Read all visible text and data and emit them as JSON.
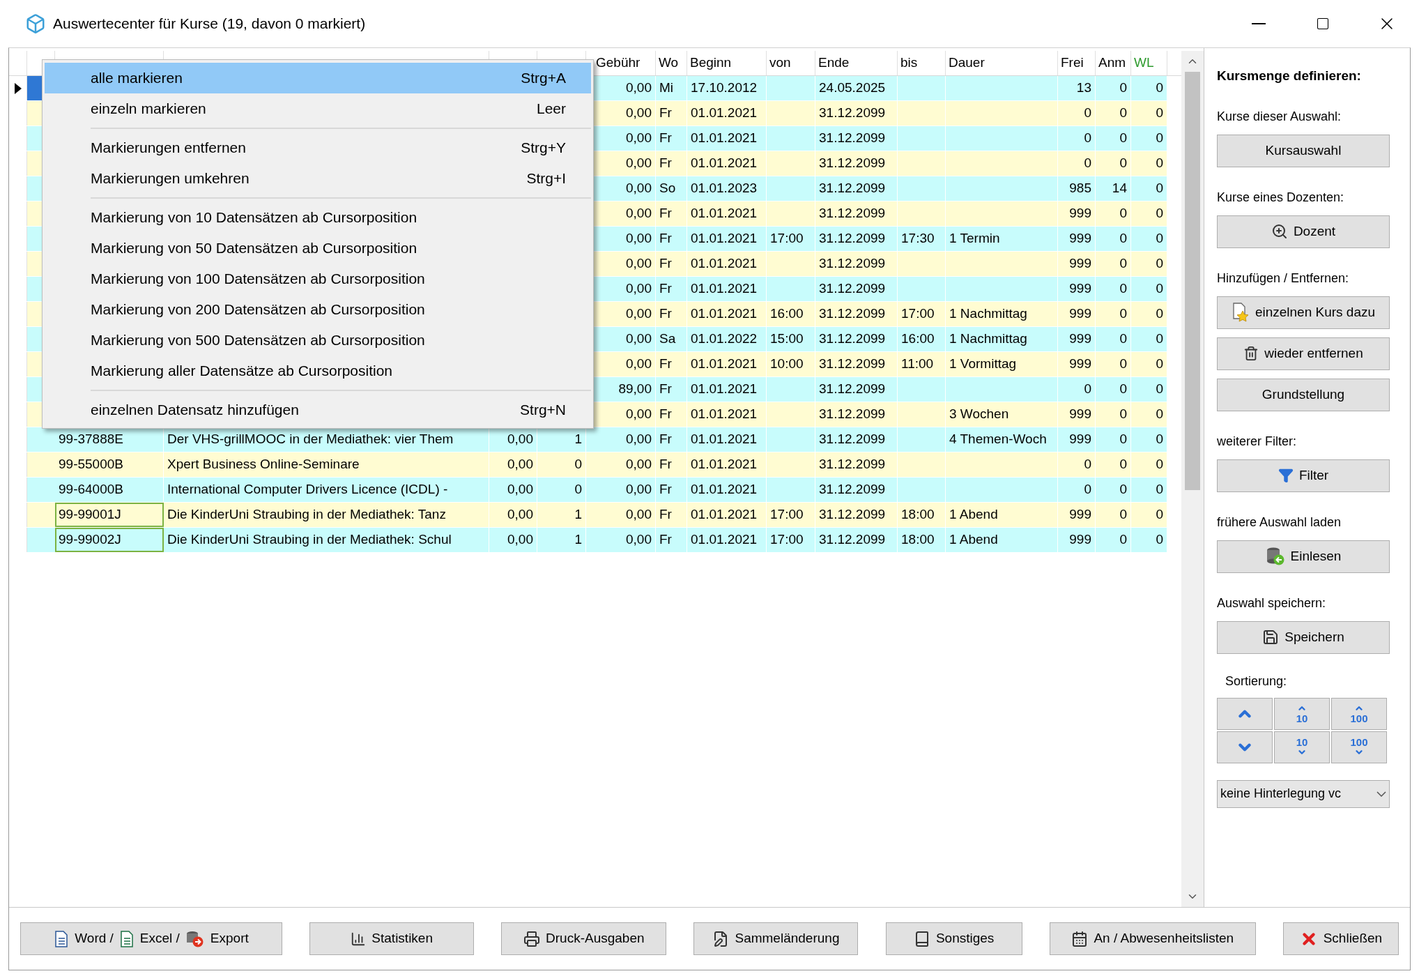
{
  "window": {
    "title": "Auswertecenter für Kurse (19, davon 0 markiert)"
  },
  "table": {
    "columns": [
      null,
      null,
      null,
      null,
      "Gebühr",
      "Wo",
      "Beginn",
      "von",
      "Ende",
      "bis",
      "Dauer",
      "Frei",
      "Anm",
      "WL"
    ],
    "rows": [
      {
        "current": true,
        "cells": [
          null,
          null,
          null,
          null,
          "0,00",
          "Mi",
          "17.10.2012",
          null,
          "24.05.2025",
          null,
          null,
          "13",
          "0",
          "0"
        ]
      },
      {
        "current": false,
        "cells": [
          null,
          null,
          null,
          null,
          "0,00",
          "Fr",
          "01.01.2021",
          null,
          "31.12.2099",
          null,
          null,
          "0",
          "0",
          "0"
        ]
      },
      {
        "current": false,
        "cells": [
          null,
          null,
          null,
          null,
          "0,00",
          "Fr",
          "01.01.2021",
          null,
          "31.12.2099",
          null,
          null,
          "0",
          "0",
          "0"
        ]
      },
      {
        "current": false,
        "cells": [
          null,
          null,
          null,
          null,
          "0,00",
          "Fr",
          "01.01.2021",
          null,
          "31.12.2099",
          null,
          null,
          "0",
          "0",
          "0"
        ]
      },
      {
        "current": false,
        "cells": [
          null,
          null,
          null,
          null,
          "0,00",
          "So",
          "01.01.2023",
          null,
          "31.12.2099",
          null,
          null,
          "985",
          "14",
          "0"
        ]
      },
      {
        "current": false,
        "cells": [
          null,
          null,
          null,
          null,
          "0,00",
          "Fr",
          "01.01.2021",
          null,
          "31.12.2099",
          null,
          null,
          "999",
          "0",
          "0"
        ]
      },
      {
        "current": false,
        "cells": [
          null,
          null,
          null,
          null,
          "0,00",
          "Fr",
          "01.01.2021",
          "17:00",
          "31.12.2099",
          "17:30",
          "1 Termin",
          "999",
          "0",
          "0"
        ]
      },
      {
        "current": false,
        "cells": [
          null,
          null,
          null,
          null,
          "0,00",
          "Fr",
          "01.01.2021",
          null,
          "31.12.2099",
          null,
          null,
          "999",
          "0",
          "0"
        ]
      },
      {
        "current": false,
        "cells": [
          null,
          null,
          null,
          null,
          "0,00",
          "Fr",
          "01.01.2021",
          null,
          "31.12.2099",
          null,
          null,
          "999",
          "0",
          "0"
        ]
      },
      {
        "current": false,
        "cells": [
          null,
          null,
          null,
          null,
          "0,00",
          "Fr",
          "01.01.2021",
          "16:00",
          "31.12.2099",
          "17:00",
          "1 Nachmittag",
          "999",
          "0",
          "0"
        ]
      },
      {
        "current": false,
        "cells": [
          null,
          null,
          null,
          null,
          "0,00",
          "Sa",
          "01.01.2022",
          "15:00",
          "31.12.2099",
          "16:00",
          "1 Nachmittag",
          "999",
          "0",
          "0"
        ]
      },
      {
        "current": false,
        "cells": [
          null,
          null,
          null,
          null,
          "0,00",
          "Fr",
          "01.01.2021",
          "10:00",
          "31.12.2099",
          "11:00",
          "1 Vormittag",
          "999",
          "0",
          "0"
        ]
      },
      {
        "current": false,
        "cells": [
          null,
          null,
          null,
          null,
          "89,00",
          "Fr",
          "01.01.2021",
          null,
          "31.12.2099",
          null,
          null,
          "0",
          "0",
          "0"
        ]
      },
      {
        "current": false,
        "cells": [
          null,
          null,
          null,
          null,
          "0,00",
          "Fr",
          "01.01.2021",
          null,
          "31.12.2099",
          null,
          "3 Wochen",
          "999",
          "0",
          "0"
        ]
      },
      {
        "current": false,
        "highlighted": false,
        "cells": [
          "99-37888E",
          "Der VHS-grillMOOC in der Mediathek: vier Them",
          "0,00",
          "1",
          "0,00",
          "Fr",
          "01.01.2021",
          null,
          "31.12.2099",
          null,
          "4 Themen-Woch",
          "999",
          "0",
          "0"
        ]
      },
      {
        "current": false,
        "highlighted": false,
        "cells": [
          "99-55000B",
          "Xpert Business Online-Seminare",
          "0,00",
          "0",
          "0,00",
          "Fr",
          "01.01.2021",
          null,
          "31.12.2099",
          null,
          null,
          "0",
          "0",
          "0"
        ]
      },
      {
        "current": false,
        "highlighted": false,
        "cells": [
          "99-64000B",
          "International Computer Drivers Licence (ICDL) -",
          "0,00",
          "0",
          "0,00",
          "Fr",
          "01.01.2021",
          null,
          "31.12.2099",
          null,
          null,
          "0",
          "0",
          "0"
        ]
      },
      {
        "current": false,
        "highlighted": true,
        "cells": [
          "99-99001J",
          "Die KinderUni Straubing in der Mediathek: Tanz",
          "0,00",
          "1",
          "0,00",
          "Fr",
          "01.01.2021",
          "17:00",
          "31.12.2099",
          "18:00",
          "1 Abend",
          "999",
          "0",
          "0"
        ]
      },
      {
        "current": false,
        "highlighted": true,
        "cells": [
          "99-99002J",
          "Die KinderUni Straubing in der Mediathek: Schul",
          "0,00",
          "1",
          "0,00",
          "Fr",
          "01.01.2021",
          "17:00",
          "31.12.2099",
          "18:00",
          "1 Abend",
          "999",
          "0",
          "0"
        ]
      }
    ]
  },
  "context_menu": {
    "groups": [
      [
        {
          "label": "alle markieren",
          "shortcut": "Strg+A",
          "selected": true
        },
        {
          "label": "einzeln markieren",
          "shortcut": "Leer",
          "selected": false
        }
      ],
      [
        {
          "label": "Markierungen entfernen",
          "shortcut": "Strg+Y",
          "selected": false
        },
        {
          "label": "Markierungen umkehren",
          "shortcut": "Strg+I",
          "selected": false
        }
      ],
      [
        {
          "label": "Markierung von 10 Datensätzen ab Cursorposition",
          "selected": false
        },
        {
          "label": "Markierung von 50 Datensätzen ab Cursorposition",
          "selected": false
        },
        {
          "label": "Markierung von 100 Datensätzen ab Cursorposition",
          "selected": false
        },
        {
          "label": "Markierung von 200 Datensätzen ab Cursorposition",
          "selected": false
        },
        {
          "label": "Markierung von 500 Datensätzen ab Cursorposition",
          "selected": false
        },
        {
          "label": "Markierung aller Datensätze ab Cursorposition",
          "selected": false
        }
      ],
      [
        {
          "label": "einzelnen Datensatz hinzufügen",
          "shortcut": "Strg+N",
          "selected": false
        }
      ]
    ]
  },
  "sidebar": {
    "heading": "Kursmenge definieren:",
    "sections": [
      {
        "label": "Kurse dieser Auswahl:",
        "buttons": [
          {
            "label": "Kursauswahl",
            "kind": "plain"
          }
        ]
      },
      {
        "label": "Kurse eines Dozenten:",
        "buttons": [
          {
            "label": "Dozent",
            "kind": "search"
          }
        ]
      },
      {
        "label": "Hinzufügen / Entfernen:",
        "buttons": [
          {
            "label": "einzelnen Kurs dazu",
            "kind": "add"
          },
          {
            "label": "wieder entfernen",
            "kind": "delete"
          },
          {
            "label": "Grundstellung",
            "kind": "plain"
          }
        ]
      },
      {
        "label": "weiterer Filter:",
        "buttons": [
          {
            "label": "Filter",
            "kind": "filter"
          }
        ]
      },
      {
        "label": "frühere Auswahl laden",
        "buttons": [
          {
            "label": "Einlesen",
            "kind": "load"
          }
        ]
      },
      {
        "label": "Auswahl speichern:",
        "buttons": [
          {
            "label": "Speichern",
            "kind": "save"
          }
        ]
      }
    ],
    "sort_label": "Sortierung:",
    "sort_buttons": [
      {
        "kind": "up"
      },
      {
        "kind": "up",
        "label": "10"
      },
      {
        "kind": "up",
        "label": "100"
      },
      {
        "kind": "down"
      },
      {
        "kind": "down",
        "label": "10"
      },
      {
        "kind": "down",
        "label": "100"
      }
    ],
    "select": {
      "value": "keine Hinterlegung vc"
    }
  },
  "toolbar": [
    {
      "kind": "export",
      "parts": [
        "Word /",
        "Excel /",
        "Export"
      ]
    },
    {
      "kind": "stats",
      "label": "Statistiken"
    },
    {
      "kind": "print",
      "label": "Druck-Ausgaben"
    },
    {
      "kind": "edit",
      "label": "Sammeländerung"
    },
    {
      "kind": "book",
      "label": "Sonstiges"
    },
    {
      "kind": "calendar",
      "label": "An / Abwesenheitslisten"
    },
    {
      "kind": "close",
      "label": "Schließen"
    }
  ]
}
